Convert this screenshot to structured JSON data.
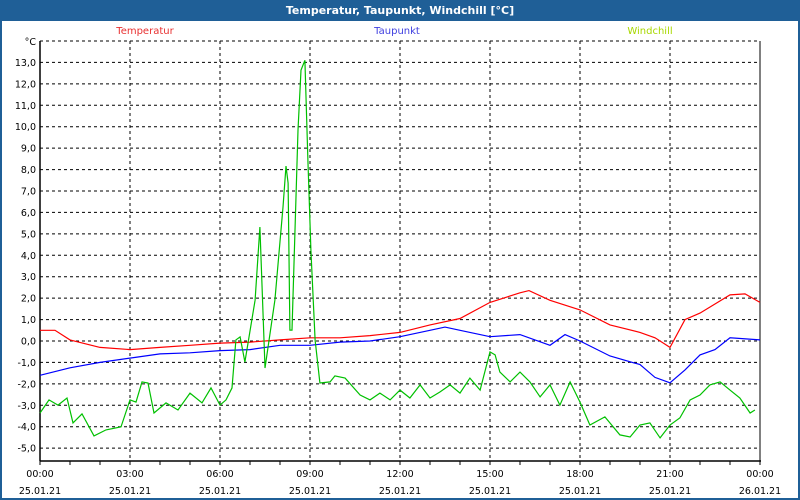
{
  "window": {
    "title": "Temperatur, Taupunkt, Windchill [°C]"
  },
  "chart_data": {
    "type": "line",
    "title": "Temperatur, Taupunkt, Windchill [°C]",
    "ylabel": "°C",
    "xlabel": "",
    "ylim": [
      -5.6,
      14
    ],
    "xlim": [
      0,
      24
    ],
    "grid": true,
    "yticks": [
      "13,0",
      "12,0",
      "11,0",
      "10,0",
      "9,0",
      "8,0",
      "7,0",
      "6,0",
      "5,0",
      "4,0",
      "3,0",
      "2,0",
      "1,0",
      "0,0",
      "-1,0",
      "-2,0",
      "-3,0",
      "-4,0",
      "-5,0"
    ],
    "ytick_values": [
      13,
      12,
      11,
      10,
      9,
      8,
      7,
      6,
      5,
      4,
      3,
      2,
      1,
      0,
      -1,
      -2,
      -3,
      -4,
      -5
    ],
    "xticks": [
      {
        "h": 0,
        "time": "00:00",
        "date": "25.01.21"
      },
      {
        "h": 3,
        "time": "03:00",
        "date": "25.01.21"
      },
      {
        "h": 6,
        "time": "06:00",
        "date": "25.01.21"
      },
      {
        "h": 9,
        "time": "09:00",
        "date": "25.01.21"
      },
      {
        "h": 12,
        "time": "12:00",
        "date": "25.01.21"
      },
      {
        "h": 15,
        "time": "15:00",
        "date": "25.01.21"
      },
      {
        "h": 18,
        "time": "18:00",
        "date": "25.01.21"
      },
      {
        "h": 21,
        "time": "21:00",
        "date": "25.01.21"
      },
      {
        "h": 24,
        "time": "00:00",
        "date": "26.01.21"
      }
    ],
    "series": [
      {
        "name": "Temperatur",
        "color": "#ff0000",
        "legend_color": "#e83030",
        "points": [
          [
            0,
            0.5
          ],
          [
            0.5,
            0.5
          ],
          [
            1,
            0.05
          ],
          [
            2,
            -0.3
          ],
          [
            3,
            -0.4
          ],
          [
            4,
            -0.3
          ],
          [
            5,
            -0.2
          ],
          [
            6,
            -0.1
          ],
          [
            7,
            -0.05
          ],
          [
            8,
            0.05
          ],
          [
            9,
            0.15
          ],
          [
            10,
            0.15
          ],
          [
            11,
            0.25
          ],
          [
            12,
            0.4
          ],
          [
            13,
            0.75
          ],
          [
            14,
            1.05
          ],
          [
            15,
            1.8
          ],
          [
            16,
            2.25
          ],
          [
            16.3,
            2.35
          ],
          [
            17,
            1.9
          ],
          [
            18,
            1.45
          ],
          [
            19,
            0.75
          ],
          [
            20,
            0.4
          ],
          [
            20.5,
            0.15
          ],
          [
            21,
            -0.3
          ],
          [
            21.5,
            1.0
          ],
          [
            22,
            1.3
          ],
          [
            23,
            2.15
          ],
          [
            23.5,
            2.2
          ],
          [
            24,
            1.8
          ]
        ]
      },
      {
        "name": "Taupunkt",
        "color": "#0000ff",
        "legend_color": "#4040e0",
        "points": [
          [
            0,
            -1.6
          ],
          [
            1,
            -1.25
          ],
          [
            2,
            -1.0
          ],
          [
            3,
            -0.8
          ],
          [
            4,
            -0.6
          ],
          [
            5,
            -0.55
          ],
          [
            6,
            -0.45
          ],
          [
            7,
            -0.4
          ],
          [
            8,
            -0.2
          ],
          [
            9,
            -0.2
          ],
          [
            10,
            -0.05
          ],
          [
            11,
            0
          ],
          [
            12,
            0.2
          ],
          [
            13,
            0.5
          ],
          [
            13.5,
            0.65
          ],
          [
            14,
            0.5
          ],
          [
            15,
            0.2
          ],
          [
            16,
            0.3
          ],
          [
            17,
            -0.2
          ],
          [
            17.5,
            0.3
          ],
          [
            18,
            0
          ],
          [
            19,
            -0.7
          ],
          [
            20,
            -1.1
          ],
          [
            20.5,
            -1.7
          ],
          [
            21,
            -1.95
          ],
          [
            21.5,
            -1.35
          ],
          [
            22,
            -0.65
          ],
          [
            22.5,
            -0.4
          ],
          [
            23,
            0.15
          ],
          [
            24,
            0.05
          ]
        ]
      },
      {
        "name": "Windchill",
        "color": "#00c000",
        "legend_color": "#a8d800",
        "points": [
          [
            0,
            -3.36
          ],
          [
            0.3,
            -2.75
          ],
          [
            0.6,
            -2.99
          ],
          [
            0.9,
            -2.66
          ],
          [
            1.1,
            -3.82
          ],
          [
            1.4,
            -3.4
          ],
          [
            1.8,
            -4.43
          ],
          [
            2.2,
            -4.15
          ],
          [
            2.7,
            -4.01
          ],
          [
            3.0,
            -2.75
          ],
          [
            3.2,
            -2.85
          ],
          [
            3.4,
            -1.91
          ],
          [
            3.6,
            -1.96
          ],
          [
            3.8,
            -3.36
          ],
          [
            4.2,
            -2.89
          ],
          [
            4.6,
            -3.22
          ],
          [
            5.0,
            -2.43
          ],
          [
            5.4,
            -2.89
          ],
          [
            5.7,
            -2.19
          ],
          [
            6.0,
            -2.99
          ],
          [
            6.2,
            -2.75
          ],
          [
            6.4,
            -2.19
          ],
          [
            6.53,
            0.05
          ],
          [
            6.67,
            0.19
          ],
          [
            6.83,
            -0.98
          ],
          [
            7.17,
            1.91
          ],
          [
            7.33,
            5.32
          ],
          [
            7.5,
            -1.26
          ],
          [
            7.83,
            1.91
          ],
          [
            8.1,
            6.25
          ],
          [
            8.2,
            8.16
          ],
          [
            8.27,
            7.37
          ],
          [
            8.33,
            0.51
          ],
          [
            8.4,
            0.51
          ],
          [
            8.6,
            9.84
          ],
          [
            8.7,
            12.64
          ],
          [
            8.83,
            13.1
          ],
          [
            8.93,
            8.44
          ],
          [
            9.03,
            4.24
          ],
          [
            9.17,
            0.05
          ],
          [
            9.33,
            -1.96
          ],
          [
            9.67,
            -1.91
          ],
          [
            9.83,
            -1.63
          ],
          [
            10.17,
            -1.73
          ],
          [
            10.67,
            -2.52
          ],
          [
            11.0,
            -2.75
          ],
          [
            11.33,
            -2.43
          ],
          [
            11.67,
            -2.75
          ],
          [
            12.0,
            -2.29
          ],
          [
            12.33,
            -2.66
          ],
          [
            12.67,
            -2.05
          ],
          [
            13.0,
            -2.66
          ],
          [
            13.33,
            -2.38
          ],
          [
            13.67,
            -2.05
          ],
          [
            14.0,
            -2.43
          ],
          [
            14.33,
            -1.73
          ],
          [
            14.67,
            -2.29
          ],
          [
            15.0,
            -0.51
          ],
          [
            15.17,
            -0.65
          ],
          [
            15.33,
            -1.45
          ],
          [
            15.67,
            -1.91
          ],
          [
            16.0,
            -1.45
          ],
          [
            16.33,
            -1.91
          ],
          [
            16.67,
            -2.61
          ],
          [
            17.0,
            -2.05
          ],
          [
            17.33,
            -2.99
          ],
          [
            17.67,
            -1.91
          ],
          [
            18.0,
            -2.85
          ],
          [
            18.33,
            -3.92
          ],
          [
            18.83,
            -3.54
          ],
          [
            19.33,
            -4.38
          ],
          [
            19.67,
            -4.48
          ],
          [
            20.0,
            -3.92
          ],
          [
            20.33,
            -3.82
          ],
          [
            20.67,
            -4.52
          ],
          [
            21.0,
            -3.92
          ],
          [
            21.33,
            -3.59
          ],
          [
            21.67,
            -2.75
          ],
          [
            22.0,
            -2.52
          ],
          [
            22.33,
            -2.05
          ],
          [
            22.67,
            -1.91
          ],
          [
            23.0,
            -2.29
          ],
          [
            23.33,
            -2.66
          ],
          [
            23.67,
            -3.36
          ],
          [
            23.83,
            -3.22
          ]
        ]
      }
    ]
  }
}
